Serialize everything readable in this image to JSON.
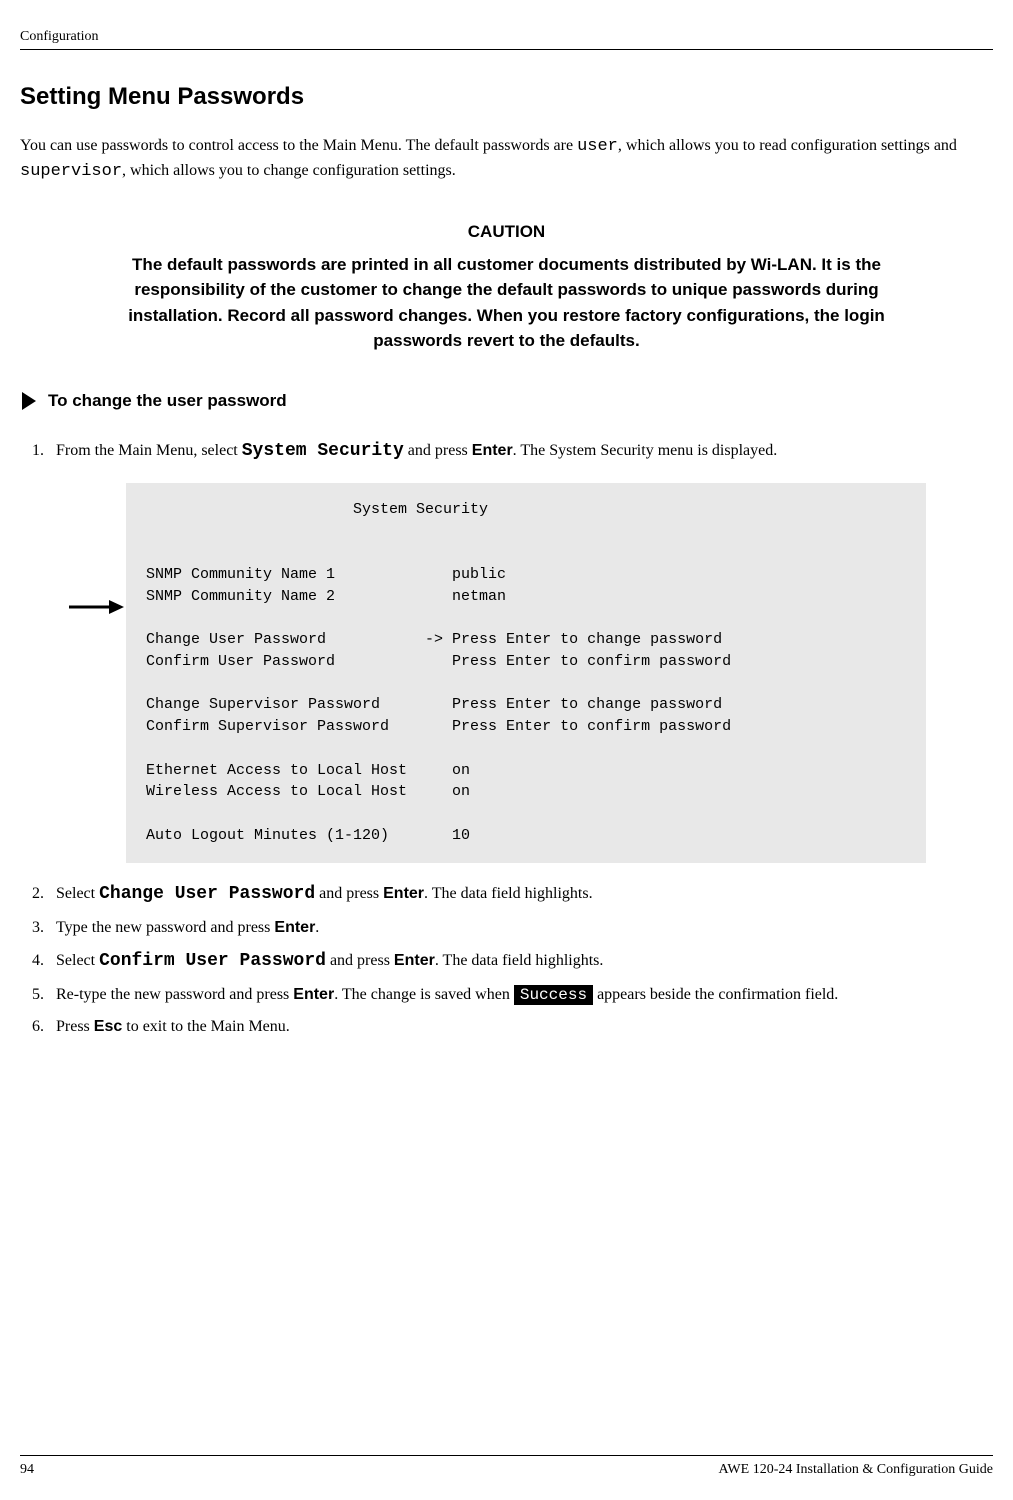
{
  "header": {
    "section": "Configuration"
  },
  "title": "Setting Menu Passwords",
  "intro": {
    "part1": "You can use passwords to control access to the Main Menu. The default passwords are ",
    "code1": "user",
    "part2": ", which allows you to read configuration settings and ",
    "code2": "supervisor",
    "part3": ", which allows you to change configuration settings."
  },
  "caution": {
    "title": "CAUTION",
    "text": "The default passwords are printed in all customer documents distributed by Wi-LAN. It is the responsibility of the customer to change the default passwords to unique passwords during installation. Record all password changes. When you restore factory configurations, the login passwords revert to the defaults."
  },
  "procedure_heading": "To change the user password",
  "steps": {
    "s1": {
      "a": "From the Main Menu, select ",
      "code1": "System Security",
      "b": " and press ",
      "key1": "Enter",
      "c": ". The System Security menu is displayed."
    },
    "s2": {
      "a": "Select ",
      "code1": "Change User Password",
      "b": " and press ",
      "key1": "Enter",
      "c": ". The data field highlights."
    },
    "s3": {
      "a": "Type the new password and press ",
      "key1": "Enter",
      "b": "."
    },
    "s4": {
      "a": "Select ",
      "code1": "Confirm User Password",
      "b": " and press ",
      "key1": "Enter",
      "c": ". The data field highlights."
    },
    "s5": {
      "a": "Re-type the new password and press ",
      "key1": "Enter",
      "b": ". The change is saved when ",
      "badge": "Success",
      "c": " appears beside the confirmation field."
    },
    "s6": {
      "a": "Press ",
      "key1": "Esc",
      "b": " to exit to the Main Menu."
    }
  },
  "terminal": "                       System Security\n\n\nSNMP Community Name 1             public\nSNMP Community Name 2             netman\n\nChange User Password           -> Press Enter to change password\nConfirm User Password             Press Enter to confirm password\n\nChange Supervisor Password        Press Enter to change password\nConfirm Supervisor Password       Press Enter to confirm password\n\nEthernet Access to Local Host     on\nWireless Access to Local Host     on\n\nAuto Logout Minutes (1-120)       10",
  "footer": {
    "page": "94",
    "guide": "AWE 120-24 Installation & Configuration Guide"
  }
}
